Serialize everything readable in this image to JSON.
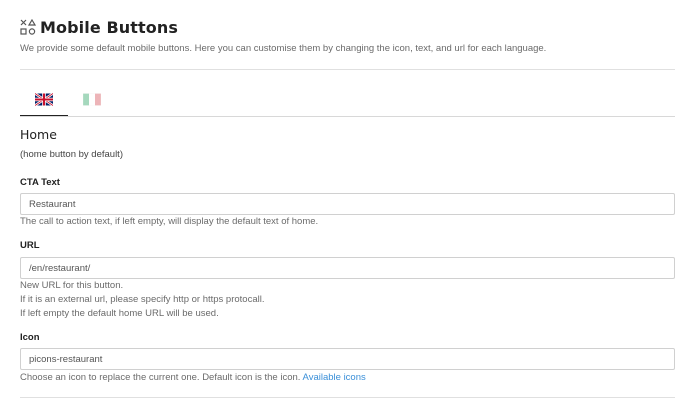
{
  "header": {
    "title": "Mobile Buttons",
    "description": "We provide some default mobile buttons. Here you can customise them by changing the icon, text, and url for each language."
  },
  "tabs": [
    {
      "language": "English",
      "flag": "uk-flag-icon",
      "active": true
    },
    {
      "language": "Italian",
      "flag": "italy-flag-icon",
      "active": false
    }
  ],
  "section": {
    "title": "Home",
    "subtitle": "(home button by default)"
  },
  "fields": {
    "cta": {
      "label": "CTA Text",
      "value": "Restaurant",
      "help": "The call to action text, if left empty, will display the default text of home."
    },
    "url": {
      "label": "URL",
      "value": "/en/restaurant/",
      "help_lines": [
        "New URL for this button.",
        "If it is an external url, please specify http or https protocall.",
        "If left empty the default home URL will be used."
      ]
    },
    "icon": {
      "label": "Icon",
      "value": "picons-restaurant",
      "help": "Choose an icon to replace the current one. Default icon is the icon.",
      "help_link": "Available icons"
    }
  },
  "colors": {
    "link": "#3a8fd8",
    "active_tab_underline": "#222222"
  }
}
